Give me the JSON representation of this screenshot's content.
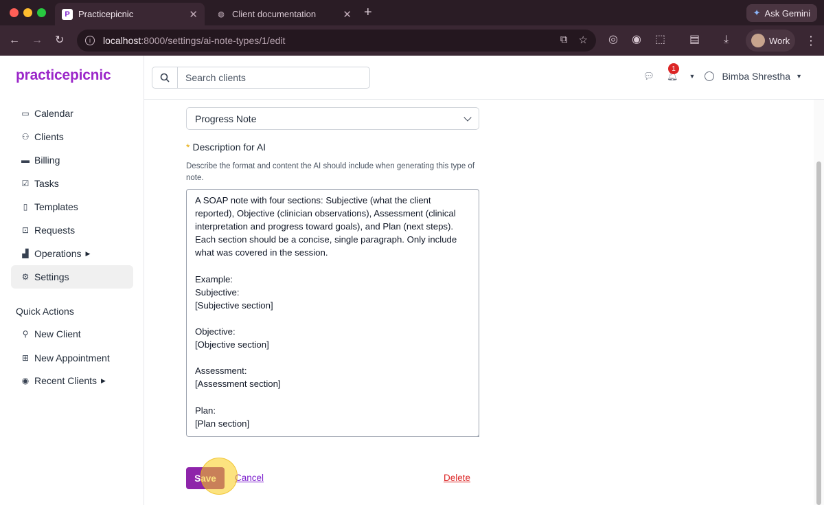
{
  "browser": {
    "tabs": [
      {
        "title": "Practicepicnic",
        "favicon": "P",
        "active": true
      },
      {
        "title": "Client documentation",
        "favicon": "globe-icon",
        "active": false
      }
    ],
    "new_tab_icon": "+",
    "gemini_label": "Ask Gemini",
    "url_host": "localhost",
    "url_path": ":8000/settings/ai-note-types/1/edit",
    "profile_label": "Work"
  },
  "app": {
    "brand": "practicepicnic",
    "search": {
      "placeholder": "Search clients"
    },
    "notifications_count": "1",
    "user_name": "Bimba Shrestha",
    "sidebar": {
      "items": [
        {
          "label": "Calendar",
          "icon": "calendar-icon"
        },
        {
          "label": "Clients",
          "icon": "users-icon"
        },
        {
          "label": "Billing",
          "icon": "billing-icon"
        },
        {
          "label": "Tasks",
          "icon": "checkbox-icon"
        },
        {
          "label": "Templates",
          "icon": "clipboard-icon"
        },
        {
          "label": "Requests",
          "icon": "inbox-icon"
        },
        {
          "label": "Operations",
          "icon": "chart-icon",
          "has_submenu": true
        },
        {
          "label": "Settings",
          "icon": "gear-icon",
          "active": true
        }
      ],
      "quick_actions_title": "Quick Actions",
      "quick_actions": [
        {
          "label": "New Client",
          "icon": "add-user-icon"
        },
        {
          "label": "New Appointment",
          "icon": "add-calendar-icon"
        },
        {
          "label": "Recent Clients",
          "icon": "eye-icon",
          "has_submenu": true
        }
      ]
    },
    "form": {
      "type_value": "Progress Note",
      "description_label": "Description for AI",
      "description_help": "Describe the format and content the AI should include when generating this type of note.",
      "description_value": "A SOAP note with four sections: Subjective (what the client reported), Objective (clinician observations), Assessment (clinical interpretation and progress toward goals), and Plan (next steps). Each section should be a concise, single paragraph. Only include what was covered in the session.\n\nExample:\nSubjective:\n[Subjective section]\n\nObjective:\n[Objective section]\n\nAssessment:\n[Assessment section]\n\nPlan:\n[Plan section]",
      "save_label": "Save",
      "cancel_label": "Cancel",
      "delete_label": "Delete"
    }
  }
}
